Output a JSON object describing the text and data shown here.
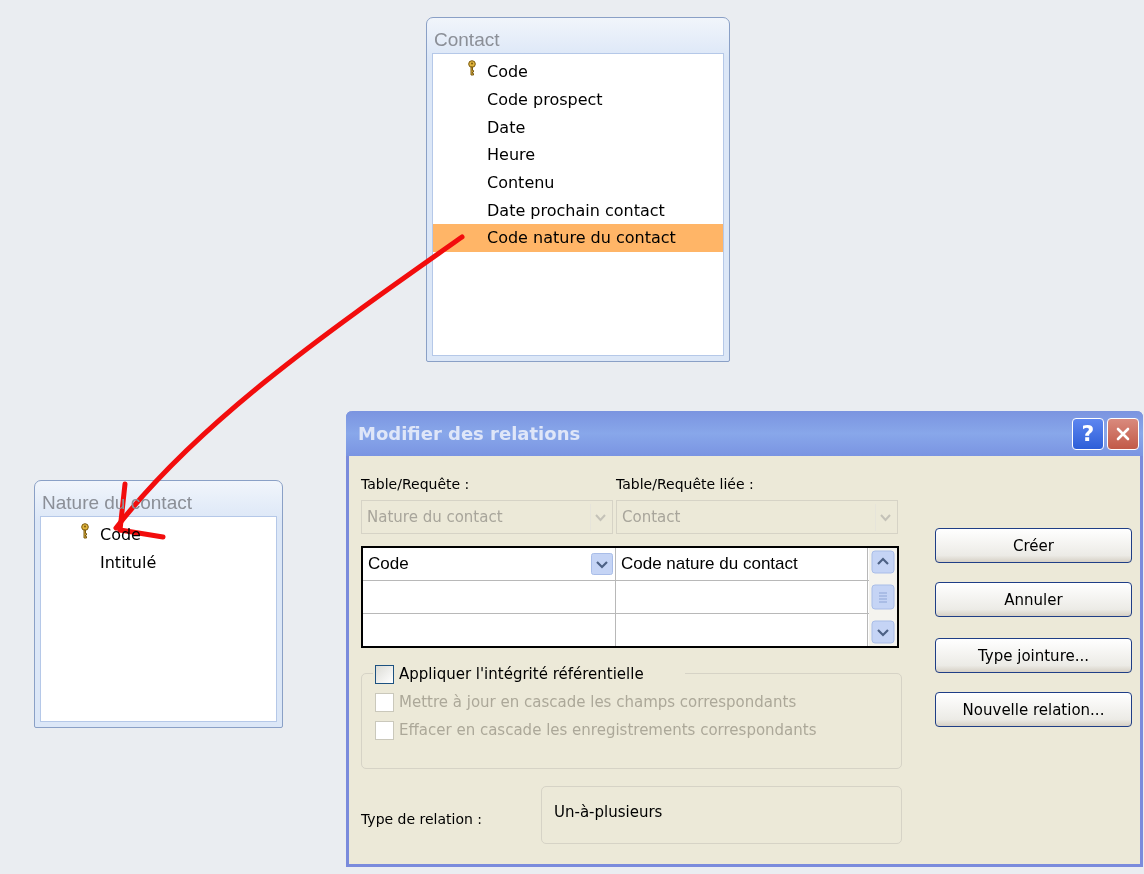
{
  "tables": [
    {
      "title": "Contact",
      "fields": [
        {
          "name": "Code",
          "primary_key": true,
          "selected": false
        },
        {
          "name": "Code prospect",
          "primary_key": false,
          "selected": false
        },
        {
          "name": "Date",
          "primary_key": false,
          "selected": false
        },
        {
          "name": "Heure",
          "primary_key": false,
          "selected": false
        },
        {
          "name": "Contenu",
          "primary_key": false,
          "selected": false
        },
        {
          "name": "Date prochain contact",
          "primary_key": false,
          "selected": false
        },
        {
          "name": "Code nature du contact",
          "primary_key": false,
          "selected": true
        }
      ]
    },
    {
      "title": "Nature du contact",
      "fields": [
        {
          "name": "Code",
          "primary_key": true,
          "selected": false
        },
        {
          "name": "Intitulé",
          "primary_key": false,
          "selected": false
        }
      ]
    }
  ],
  "dialog": {
    "title": "Modifier des relations",
    "help_button": "?",
    "table_label": "Table/Requête :",
    "related_label": "Table/Requête liée :",
    "table_combo": {
      "value": "Nature du contact",
      "disabled": true
    },
    "related_combo": {
      "value": "Contact",
      "disabled": true
    },
    "grid_rows": [
      {
        "left": "Code",
        "right": "Code nature du contact"
      }
    ],
    "checkboxes": [
      {
        "label": "Appliquer l'intégrité référentielle",
        "checked": false,
        "disabled": false
      },
      {
        "label": "Mettre à jour en cascade les champs correspondants",
        "checked": false,
        "disabled": true
      },
      {
        "label": "Effacer en cascade les enregistrements correspondants",
        "checked": false,
        "disabled": true
      }
    ],
    "relation_type_label": "Type de relation :",
    "relation_type": "Un-à-plusieurs",
    "buttons": [
      "Créer",
      "Annuler",
      "Type jointure...",
      "Nouvelle relation..."
    ]
  }
}
